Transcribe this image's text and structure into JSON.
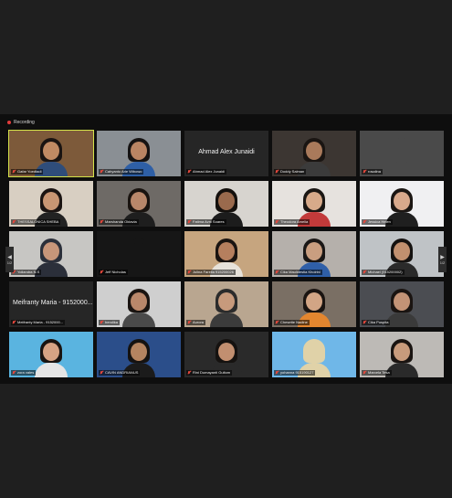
{
  "recording": {
    "label": "Recording"
  },
  "pager": {
    "left_label": "1/2",
    "right_label": "1/2",
    "left_icon": "chevron-left-icon",
    "right_icon": "chevron-right-icon"
  },
  "accent": {
    "active_speaker_border": "#d4e34a",
    "muted_mic": "#e5483d",
    "recording_dot": "#e23b3b"
  },
  "participants": [
    {
      "name": "Gafar Yoedtadi",
      "active": true,
      "video": true,
      "muted": true,
      "bg": "#7d5a3a",
      "skin": "#c08a63",
      "hair": "#1a1412",
      "shirt": "#2f4d7a"
    },
    {
      "name": "Cahyanto Arie Wibowo",
      "video": true,
      "muted": true,
      "bg": "#8a8f94",
      "skin": "#b98463",
      "hair": "#151212",
      "shirt": "#2e5fa6"
    },
    {
      "name": "Ahmad Alex Junaidi",
      "video": false,
      "muted": true,
      "big": "Ahmad Alex Junaidi"
    },
    {
      "name": "Doddy Salman",
      "video": true,
      "muted": true,
      "bg": "#3c3632",
      "skin": "#a97a5b",
      "hair": "#1a1512",
      "shirt": "#3b3b3b"
    },
    {
      "name": "rosalina",
      "video": true,
      "muted": true,
      "bg": "#4a4a4a",
      "skin": "#4a4a4a",
      "hair": "#4a4a4a",
      "shirt": "#4a4a4a"
    },
    {
      "name": "THESSALONICA SHEBA",
      "video": true,
      "muted": true,
      "bg": "#d8cfc2",
      "skin": "#c99673",
      "hair": "#1b1412",
      "shirt": "#222222"
    },
    {
      "name": "Marshanda Oktavia",
      "video": true,
      "muted": true,
      "bg": "#6e6a66",
      "skin": "#b8876a",
      "hair": "#19130f",
      "shirt": "#1e1e1e"
    },
    {
      "name": "Fatima Avni Soares",
      "video": true,
      "muted": true,
      "bg": "#d7d4cf",
      "skin": "#9a6a4d",
      "hair": "#14100d",
      "shirt": "#1c1c1c"
    },
    {
      "name": "Theodora Amelia",
      "video": true,
      "muted": true,
      "bg": "#e6e2de",
      "skin": "#d7aa8a",
      "hair": "#1a1613",
      "shirt": "#c23a3a"
    },
    {
      "name": "Jessica Helen",
      "video": true,
      "muted": true,
      "bg": "#f0f0f2",
      "skin": "#d8a98c",
      "hair": "#1b1613",
      "shirt": "#1f1f1f"
    },
    {
      "name": "Yoliandra N.S",
      "video": true,
      "muted": true,
      "bg": "#c7c6c3",
      "skin": "#c8967a",
      "hair": "#2b2f3a",
      "shirt": "#2b2f3a"
    },
    {
      "name": "Jeff Nicholas",
      "video": true,
      "muted": true,
      "bg": "#161616",
      "skin": "#161616",
      "hair": "#161616",
      "shirt": "#161616"
    },
    {
      "name": "Julina Farella 915200026",
      "video": true,
      "muted": true,
      "bg": "#c6a57f",
      "skin": "#b57f5e",
      "hair": "#1a1411",
      "shirt": "#e7e2da"
    },
    {
      "name": "Cika Maulidestia Khoirini",
      "video": true,
      "muted": true,
      "bg": "#b5b0ab",
      "skin": "#c99e80",
      "hair": "#1a1716",
      "shirt": "#2f5fa8"
    },
    {
      "name": "Michael (915200002)",
      "video": true,
      "muted": true,
      "bg": "#bfc3c6",
      "skin": "#c1906f",
      "hair": "#151210",
      "shirt": "#2a2a2a"
    },
    {
      "name": "Meifranty Maria - 9152000...",
      "video": false,
      "muted": true,
      "big": "Meifranty Maria - 9152000..."
    },
    {
      "name": "hendika",
      "video": true,
      "muted": true,
      "bg": "#cfcfcf",
      "skin": "#b9876a",
      "hair": "#1a1411",
      "shirt": "#4a4a4a"
    },
    {
      "name": "Aurora",
      "video": true,
      "muted": true,
      "bg": "#b9a690",
      "skin": "#c79a7c",
      "hair": "#2b2b2b",
      "shirt": "#3b3b3b"
    },
    {
      "name": "Chesette Nadine",
      "video": true,
      "muted": true,
      "bg": "#7a6f64",
      "skin": "#d2a585",
      "hair": "#1a1411",
      "shirt": "#e3862f"
    },
    {
      "name": "Cika Puspita",
      "video": true,
      "muted": true,
      "bg": "#4b4d52",
      "skin": "#c39376",
      "hair": "#1a1411",
      "shirt": "#3a3a3a"
    },
    {
      "name": "zora vales",
      "video": true,
      "muted": true,
      "bg": "#5ab4e0",
      "skin": "#d6a384",
      "hair": "#1a1411",
      "shirt": "#e5e5e5"
    },
    {
      "name": "CAVIN ANDRIANUS",
      "video": true,
      "muted": true,
      "bg": "#2b4e8a",
      "skin": "#b58460",
      "hair": "#151210",
      "shirt": "#1b1b1b"
    },
    {
      "name": "Rini Dumayanti Gultom",
      "video": true,
      "muted": true,
      "bg": "#2a2a2a",
      "skin": "#c28f70",
      "hair": "#151210",
      "shirt": "#2a2a2a"
    },
    {
      "name": "yohanna 915190127",
      "video": true,
      "muted": true,
      "bg": "#6fb7e8",
      "skin": "#e0d2a8",
      "hair": "#e0d2a8",
      "shirt": "#e0d2a8"
    },
    {
      "name": "Marcela Tesa",
      "video": true,
      "muted": true,
      "bg": "#bdbab6",
      "skin": "#c89b7c",
      "hair": "#1a1411",
      "shirt": "#2a2a2a"
    }
  ]
}
